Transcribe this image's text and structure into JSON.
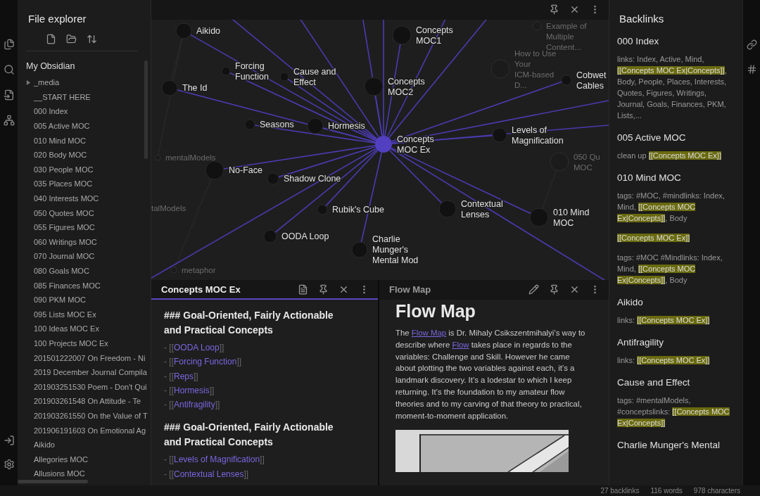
{
  "explorer": {
    "title": "File explorer",
    "root": "My Obsidian",
    "items": [
      {
        "name": "_media",
        "kind": "folder",
        "expanded": false
      },
      {
        "name": "__START HERE",
        "kind": "file"
      },
      {
        "name": "000 Index",
        "kind": "file"
      },
      {
        "name": "005 Active MOC",
        "kind": "file"
      },
      {
        "name": "010 Mind MOC",
        "kind": "file"
      },
      {
        "name": "020 Body MOC",
        "kind": "file"
      },
      {
        "name": "030 People MOC",
        "kind": "file"
      },
      {
        "name": "035 Places MOC",
        "kind": "file"
      },
      {
        "name": "040 Interests MOC",
        "kind": "file"
      },
      {
        "name": "050 Quotes MOC",
        "kind": "file"
      },
      {
        "name": "055 Figures MOC",
        "kind": "file"
      },
      {
        "name": "060 Writings MOC",
        "kind": "file"
      },
      {
        "name": "070 Journal MOC",
        "kind": "file"
      },
      {
        "name": "080 Goals MOC",
        "kind": "file"
      },
      {
        "name": "085 Finances MOC",
        "kind": "file"
      },
      {
        "name": "090 PKM MOC",
        "kind": "file"
      },
      {
        "name": "095 Lists MOC Ex",
        "kind": "file"
      },
      {
        "name": "100 Ideas MOC Ex",
        "kind": "file"
      },
      {
        "name": "100 Projects MOC Ex",
        "kind": "file"
      },
      {
        "name": "201501222007 On Freedom - Ni",
        "kind": "file"
      },
      {
        "name": "2019 December Journal Compila",
        "kind": "file"
      },
      {
        "name": "201903251530 Poem - Don't Qui",
        "kind": "file"
      },
      {
        "name": "201903261548 On Attitude - Te",
        "kind": "file"
      },
      {
        "name": "201903261550 On the Value of T",
        "kind": "file"
      },
      {
        "name": "201906191603 On Emotional Ag",
        "kind": "file"
      },
      {
        "name": "Aikido",
        "kind": "file"
      },
      {
        "name": "Allegories MOC",
        "kind": "file"
      },
      {
        "name": "Allusions MOC",
        "kind": "file"
      }
    ]
  },
  "graph": {
    "nodes": [
      {
        "label": [
          "Example of",
          "Multiple",
          "Content..."
        ],
        "kind": "dimmed"
      },
      {
        "label": [
          "Aikido"
        ],
        "kind": "node"
      },
      {
        "label": [
          "Concepts",
          "MOC1"
        ],
        "kind": "node"
      },
      {
        "label": [
          "The Id"
        ],
        "kind": "node"
      },
      {
        "label": [
          "Forcing",
          "Function"
        ],
        "kind": "node"
      },
      {
        "label": [
          "Cause and",
          "Effect"
        ],
        "kind": "node"
      },
      {
        "label": [
          "Concepts",
          "MOC2"
        ],
        "kind": "node"
      },
      {
        "label": [
          "How to Use",
          "Your",
          "ICM-based",
          "D..."
        ],
        "kind": "dimmed"
      },
      {
        "label": [
          "Cobwet",
          "Cables"
        ],
        "kind": "node"
      },
      {
        "label": [
          "Seasons"
        ],
        "kind": "node"
      },
      {
        "label": [
          "Hormesis"
        ],
        "kind": "node"
      },
      {
        "label": [
          "Concepts",
          "MOC Ex"
        ],
        "kind": "center"
      },
      {
        "label": [
          "Levels of",
          "Magnification"
        ],
        "kind": "node"
      },
      {
        "label": [
          "mentalModels"
        ],
        "kind": "dimmed"
      },
      {
        "label": [
          "050 Qu",
          "MOC"
        ],
        "kind": "dimmed"
      },
      {
        "label": [
          "No-Face"
        ],
        "kind": "node"
      },
      {
        "label": [
          "Shadow Clone"
        ],
        "kind": "node"
      },
      {
        "label": [
          "talModels"
        ],
        "kind": "offscreen"
      },
      {
        "label": [
          "Rubik's Cube"
        ],
        "kind": "node"
      },
      {
        "label": [
          "Contextual",
          "Lenses"
        ],
        "kind": "node"
      },
      {
        "label": [
          "010 Mind",
          "MOC"
        ],
        "kind": "node"
      },
      {
        "label": [
          "OODA Loop"
        ],
        "kind": "node"
      },
      {
        "label": [
          "Charlie",
          "Munger's",
          "Mental Mod"
        ],
        "kind": "node"
      },
      {
        "label": [
          "metaphor"
        ],
        "kind": "dimmed"
      }
    ]
  },
  "panes": [
    {
      "title": "Concepts MOC Ex",
      "active": true,
      "kind": "source",
      "blocks": [
        {
          "kind": "heading",
          "text": "### Goal-Oriented, Fairly Actionable and Practical Concepts"
        },
        {
          "kind": "link",
          "prefix": "- [[",
          "text": "OODA Loop",
          "suffix": "]]"
        },
        {
          "kind": "link",
          "prefix": "- [[",
          "text": "Forcing Function",
          "suffix": "]]"
        },
        {
          "kind": "link",
          "prefix": "- [[",
          "text": "Reps",
          "suffix": "]]"
        },
        {
          "kind": "link",
          "prefix": "- [[",
          "text": "Hormesis",
          "suffix": "]]"
        },
        {
          "kind": "link",
          "prefix": "- [[",
          "text": "Antifragility",
          "suffix": "]]"
        },
        {
          "kind": "heading",
          "text": "### Goal-Oriented, Fairly Actionable and Practical Concepts"
        },
        {
          "kind": "link",
          "prefix": "- [[",
          "text": "Levels of Magnification",
          "suffix": "]]"
        },
        {
          "kind": "link",
          "prefix": "- [[",
          "text": "Contextual Lenses",
          "suffix": "]]"
        }
      ]
    },
    {
      "title": "Flow Map",
      "active": false,
      "kind": "preview",
      "blocks": [
        {
          "kind": "title",
          "text": "Flow Map"
        },
        {
          "kind": "paragraph",
          "segments": [
            {
              "text": "The ",
              "link": false
            },
            {
              "text": "Flow Map",
              "link": true
            },
            {
              "text": " is Dr. Mihaly Csikszentmihalyi’s way to describe where ",
              "link": false
            },
            {
              "text": "Flow",
              "link": true
            },
            {
              "text": " takes place in regards to the variables: Challenge and Skill. However he came about plotting the two variables against each, it’s a landmark discovery. It’s a lodestar to which I keep returning. It’s the foundation to my amateur flow theories and to my carving of that theory to practical, moment-to-moment application.",
              "link": false
            }
          ]
        },
        {
          "kind": "picture"
        }
      ]
    }
  ],
  "backlinks": {
    "title": "Backlinks",
    "items": [
      {
        "title": "000 Index",
        "snippets": [
          [
            {
              "text": "links: Index, Active, Mind, ",
              "highlight": false
            },
            {
              "text": "[[Concepts MOC Ex|Concepts]]",
              "highlight": true
            },
            {
              "text": ", Body, People, Places, Interests, Quotes, Figures, Writings, Journal, Goals, Finances, PKM, Lists,...",
              "highlight": false
            }
          ]
        ]
      },
      {
        "title": "005 Active MOC",
        "snippets": [
          [
            {
              "text": "clean up ",
              "highlight": false
            },
            {
              "text": "[[Concepts MOC Ex]]",
              "highlight": true
            }
          ]
        ]
      },
      {
        "title": "010 Mind MOC",
        "snippets": [
          [
            {
              "text": "tags: #MOC, #mindlinks: Index, Mind, ",
              "highlight": false
            },
            {
              "text": "[[Concepts MOC Ex|Concepts]]",
              "highlight": true
            },
            {
              "text": ", Body",
              "highlight": false
            }
          ],
          [
            {
              "text": "[[Concepts MOC Ex]]",
              "highlight": true
            }
          ],
          [
            {
              "text": "tags: #MOC #Mindlinks: Index, Mind, ",
              "highlight": false
            },
            {
              "text": "[[Concepts MOC Ex|Concepts]]",
              "highlight": true
            },
            {
              "text": ", Body",
              "highlight": false
            }
          ]
        ]
      },
      {
        "title": "Aikido",
        "snippets": [
          [
            {
              "text": "links: ",
              "highlight": false
            },
            {
              "text": "[[Concepts MOC Ex]]",
              "highlight": true
            }
          ]
        ]
      },
      {
        "title": "Antifragility",
        "snippets": [
          [
            {
              "text": "links: ",
              "highlight": false
            },
            {
              "text": "[[Concepts MOC Ex]]",
              "highlight": true
            }
          ]
        ]
      },
      {
        "title": "Cause and Effect",
        "snippets": [
          [
            {
              "text": "tags: #mentalModels, #conceptslinks: ",
              "highlight": false
            },
            {
              "text": "[[Concepts MOC Ex|Concepts]]",
              "highlight": true
            }
          ]
        ]
      },
      {
        "title": "Charlie Munger's Mental"
      }
    ]
  },
  "status_bar": [
    "27 backlinks",
    "116 words",
    "978 characters"
  ]
}
